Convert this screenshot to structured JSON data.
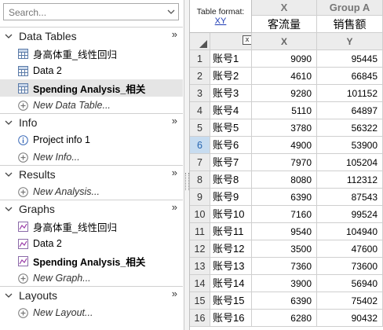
{
  "search": {
    "placeholder": "Search..."
  },
  "sections": [
    {
      "title": "Data Tables",
      "items": [
        {
          "label": "身高体重_线性回归",
          "icon": "table-icon"
        },
        {
          "label": "Data 2",
          "icon": "table-icon"
        },
        {
          "label": "Spending  Analysis_相关",
          "icon": "table-icon",
          "selected": true
        },
        {
          "label": "New Data Table...",
          "icon": "add-icon",
          "new": true
        }
      ]
    },
    {
      "title": "Info",
      "items": [
        {
          "label": "Project info 1",
          "icon": "info-icon"
        },
        {
          "label": "New Info...",
          "icon": "add-icon",
          "new": true
        }
      ]
    },
    {
      "title": "Results",
      "items": [
        {
          "label": "New Analysis...",
          "icon": "add-icon",
          "new": true
        }
      ]
    },
    {
      "title": "Graphs",
      "items": [
        {
          "label": "身高体重_线性回归",
          "icon": "graph-icon"
        },
        {
          "label": "Data 2",
          "icon": "graph-icon"
        },
        {
          "label": "Spending  Analysis_相关",
          "icon": "graph-icon",
          "bold": true
        },
        {
          "label": "New Graph...",
          "icon": "add-icon",
          "new": true
        }
      ]
    },
    {
      "title": "Layouts",
      "items": [
        {
          "label": "New Layout...",
          "icon": "add-icon",
          "new": true
        }
      ]
    }
  ],
  "grid": {
    "table_format_label": "Table format:",
    "table_format_value": "XY",
    "col_x_head": "X",
    "col_a_head": "Group A",
    "col_x_name": "客流量",
    "col_a_name": "销售额",
    "sub_x": "X",
    "sub_y": "Y",
    "x_box": "x",
    "active_row": 6,
    "rows": [
      {
        "n": "1",
        "title": "账号1",
        "x": "9090",
        "y": "95445"
      },
      {
        "n": "2",
        "title": "账号2",
        "x": "4610",
        "y": "66845"
      },
      {
        "n": "3",
        "title": "账号3",
        "x": "9280",
        "y": "101152"
      },
      {
        "n": "4",
        "title": "账号4",
        "x": "5110",
        "y": "64897"
      },
      {
        "n": "5",
        "title": "账号5",
        "x": "3780",
        "y": "56322"
      },
      {
        "n": "6",
        "title": "账号6",
        "x": "4900",
        "y": "53900"
      },
      {
        "n": "7",
        "title": "账号7",
        "x": "7970",
        "y": "105204"
      },
      {
        "n": "8",
        "title": "账号8",
        "x": "8080",
        "y": "112312"
      },
      {
        "n": "9",
        "title": "账号9",
        "x": "6390",
        "y": "87543"
      },
      {
        "n": "10",
        "title": "账号10",
        "x": "7160",
        "y": "99524"
      },
      {
        "n": "11",
        "title": "账号11",
        "x": "9540",
        "y": "104940"
      },
      {
        "n": "12",
        "title": "账号12",
        "x": "3500",
        "y": "47600"
      },
      {
        "n": "13",
        "title": "账号13",
        "x": "7360",
        "y": "73600"
      },
      {
        "n": "14",
        "title": "账号14",
        "x": "3900",
        "y": "56940"
      },
      {
        "n": "15",
        "title": "账号15",
        "x": "6390",
        "y": "75402"
      },
      {
        "n": "16",
        "title": "账号16",
        "x": "6280",
        "y": "90432"
      }
    ]
  }
}
